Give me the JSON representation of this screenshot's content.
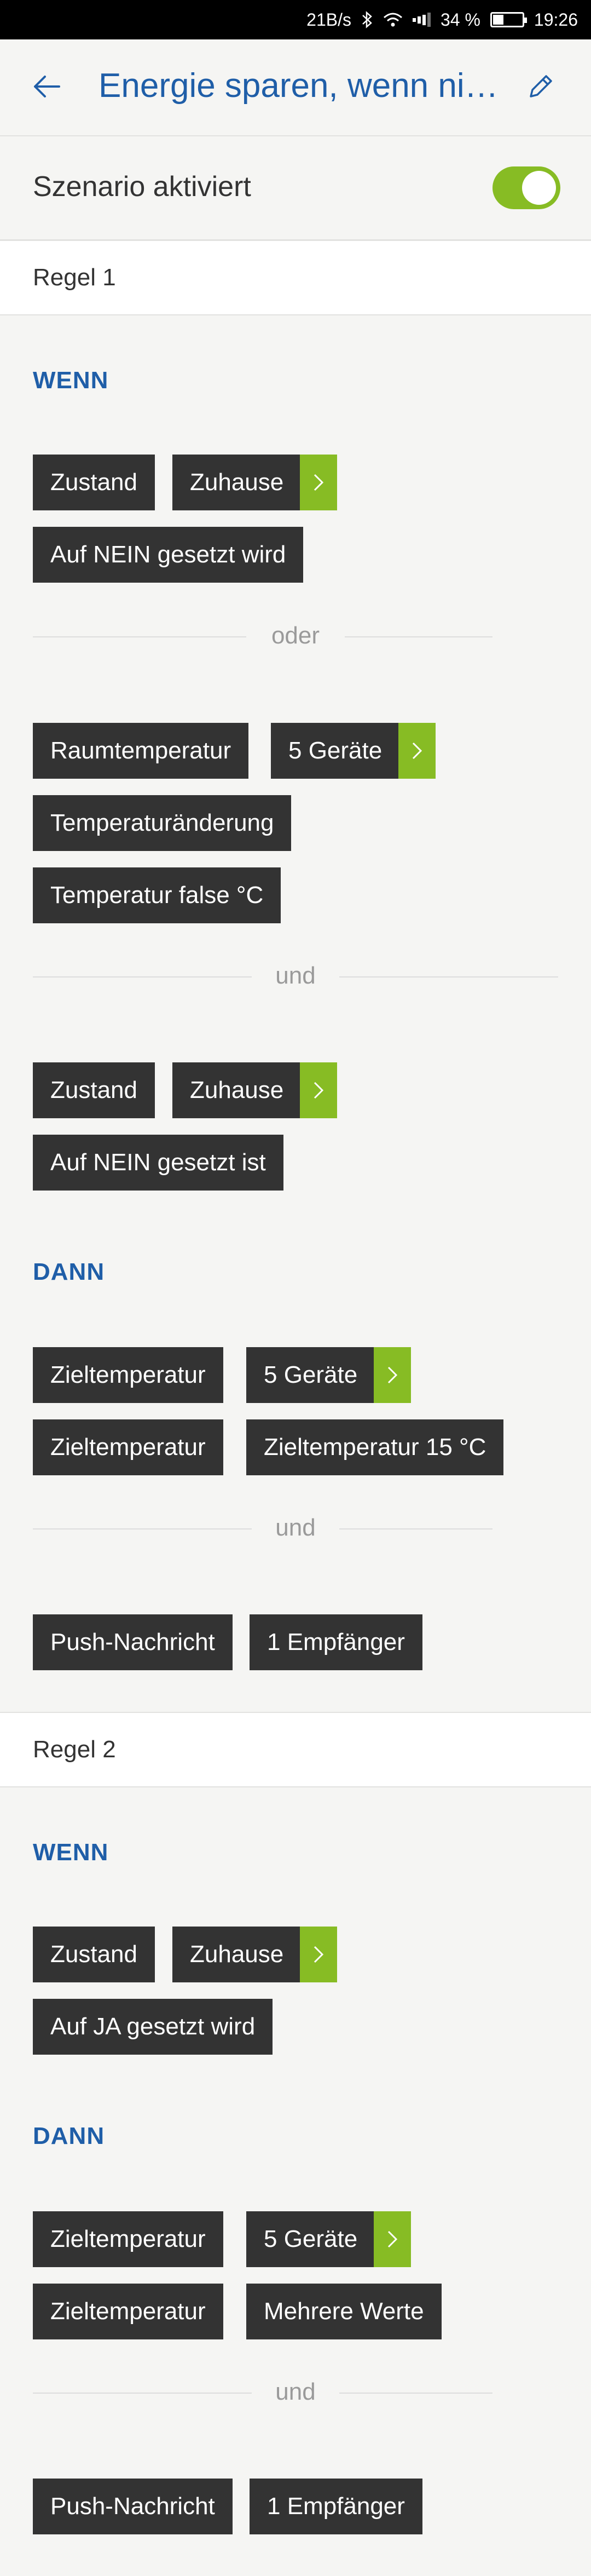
{
  "status_bar": {
    "net_speed": "21B/s",
    "battery_percent": "34 %",
    "battery_level": 0.34,
    "time": "19:26"
  },
  "header": {
    "title": "Energie sparen, wenn ni…"
  },
  "scenario": {
    "label": "Szenario aktiviert",
    "toggle_on": true
  },
  "rules": [
    {
      "title": "Regel 1",
      "wenn_label": "WENN",
      "wenn_group1": {
        "type": "Zustand",
        "target": "Zuhause",
        "condition": "Auf NEIN gesetzt wird"
      },
      "connector1": "oder",
      "wenn_group2": {
        "type": "Raumtemperatur",
        "target": "5 Geräte",
        "condition": "Temperaturänderung",
        "value": "Temperatur false °C"
      },
      "connector2": "und",
      "wenn_group3": {
        "type": "Zustand",
        "target": "Zuhause",
        "condition": "Auf NEIN gesetzt ist"
      },
      "dann_label": "DANN",
      "dann_group1": {
        "type": "Zieltemperatur",
        "target": "5 Geräte",
        "param": "Zieltemperatur",
        "value": "Zieltemperatur 15 °C"
      },
      "connector3": "und",
      "dann_group2": {
        "type": "Push-Nachricht",
        "target": "1 Empfänger"
      }
    },
    {
      "title": "Regel 2",
      "wenn_label": "WENN",
      "wenn_group1": {
        "type": "Zustand",
        "target": "Zuhause",
        "condition": "Auf JA gesetzt wird"
      },
      "dann_label": "DANN",
      "dann_group1": {
        "type": "Zieltemperatur",
        "target": "5 Geräte",
        "param": "Zieltemperatur",
        "value": "Mehrere Werte"
      },
      "connector1": "und",
      "dann_group2": {
        "type": "Push-Nachricht",
        "target": "1 Empfänger"
      }
    }
  ],
  "colors": {
    "accent_blue": "#1f5ea8",
    "accent_green": "#87bc24",
    "chip_dark": "#333333",
    "background": "#f5f5f3"
  }
}
